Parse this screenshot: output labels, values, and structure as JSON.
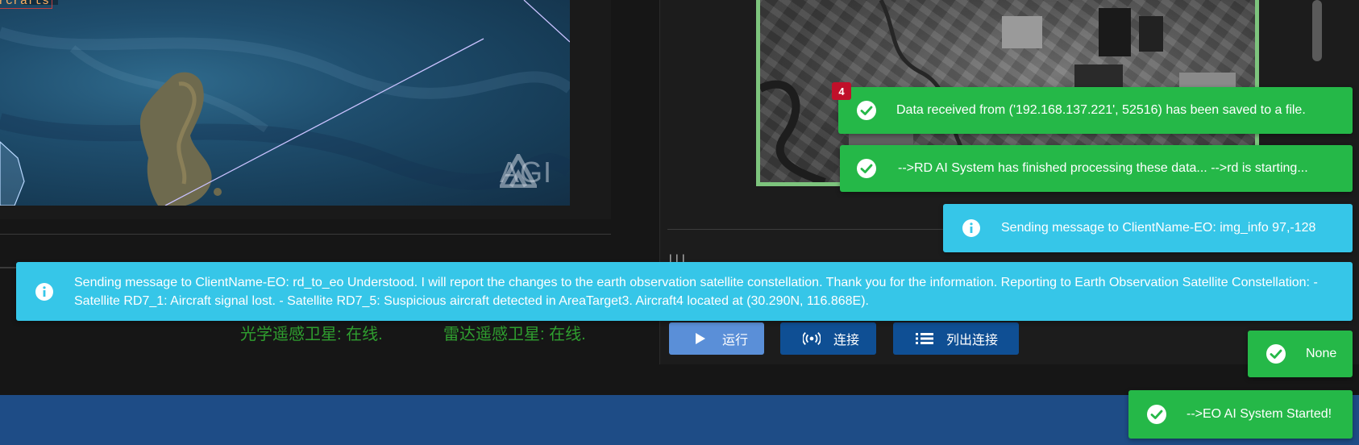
{
  "map": {
    "corner_label": "rcrafts",
    "watermark": "AGI"
  },
  "status": {
    "optical": "光学遥感卫星: 在线.",
    "radar": "雷达遥感卫星: 在线."
  },
  "right_panel": {
    "partial_label": "l    l l"
  },
  "buttons": {
    "run": "运行",
    "connect": "连接",
    "list_connections": "列出连接"
  },
  "badge": {
    "count": "4"
  },
  "toasts": [
    {
      "type": "success",
      "icon": "check-circle-icon",
      "message": "Data received from ('192.168.137.221', 52516) has been saved to a file."
    },
    {
      "type": "success",
      "icon": "check-circle-icon",
      "message": "-->RD AI System has finished processing these data... -->rd is starting..."
    },
    {
      "type": "info",
      "icon": "info-circle-icon",
      "message": "Sending message to ClientName-EO: img_info 97,-128"
    },
    {
      "type": "info",
      "icon": "info-circle-icon",
      "message": "Sending message to ClientName-EO: rd_to_eo Understood. I will report the changes to the earth observation satellite constellation. Thank you for the information. Reporting to Earth Observation Satellite Constellation: - Satellite RD7_1: Aircraft signal lost. - Satellite RD7_5: Suspicious aircraft detected in AreaTarget3. Aircraft4 located at (30.290N, 116.868E)."
    },
    {
      "type": "success",
      "icon": "check-circle-icon",
      "message": "None"
    },
    {
      "type": "success",
      "icon": "check-circle-icon",
      "message": "-->EO AI System Started!"
    }
  ],
  "colors": {
    "success": "#25b848",
    "info": "#36c6e8",
    "primary_button": "#0f4f94",
    "run_button": "#5a8fd8",
    "status_text": "#2f9e2f",
    "footer": "#1e4c86",
    "badge": "#c0102a"
  }
}
